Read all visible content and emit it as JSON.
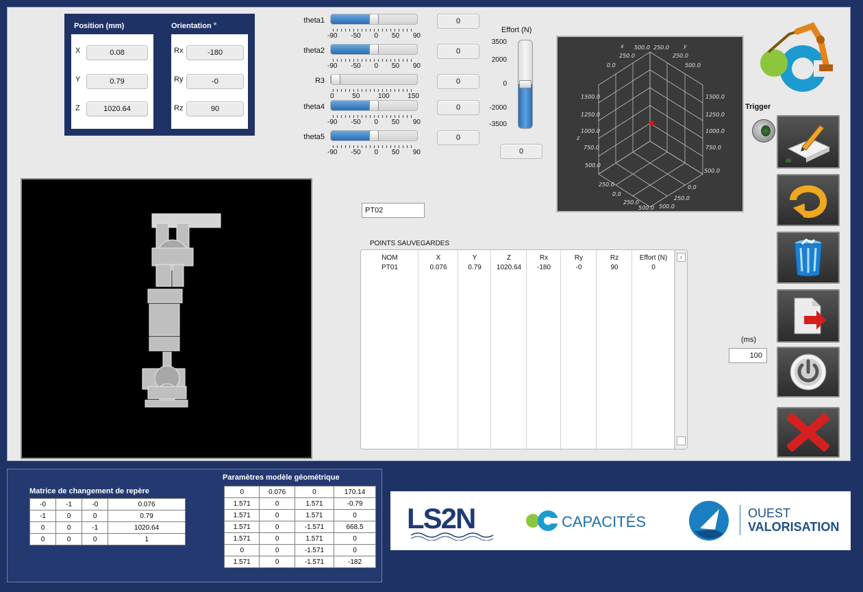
{
  "pose": {
    "position_header": "Position (mm)",
    "orientation_header": "Orientation °",
    "rows": [
      {
        "pos_label": "X",
        "pos_value": "0.08",
        "ori_label": "Rx",
        "ori_value": "-180"
      },
      {
        "pos_label": "Y",
        "pos_value": "0.79",
        "ori_label": "Ry",
        "ori_value": "-0"
      },
      {
        "pos_label": "Z",
        "pos_value": "1020.64",
        "ori_label": "Rz",
        "ori_value": "90"
      }
    ]
  },
  "joints": [
    {
      "label": "theta1",
      "value": "0",
      "fill": 0.5,
      "ticks": [
        "-90",
        "-50",
        "0",
        "50",
        "90"
      ]
    },
    {
      "label": "theta2",
      "value": "0",
      "fill": 0.5,
      "ticks": [
        "-90",
        "-50",
        "0",
        "50",
        "90"
      ]
    },
    {
      "label": "R3",
      "value": "0",
      "fill": 0.0,
      "ticks": [
        "0",
        "50",
        "100",
        "150"
      ]
    },
    {
      "label": "theta4",
      "value": "0",
      "fill": 0.5,
      "ticks": [
        "-90",
        "-50",
        "0",
        "50",
        "90"
      ]
    },
    {
      "label": "theta5",
      "value": "0",
      "fill": 0.5,
      "ticks": [
        "-90",
        "-50",
        "0",
        "50",
        "90"
      ]
    }
  ],
  "effort": {
    "title": "Effort (N)",
    "scale": [
      "3500",
      "2000",
      "0",
      "-2000",
      "-3500"
    ],
    "value": "0",
    "level": 0.5
  },
  "plot3d": {
    "labels_left": [
      "250.0",
      "0.0",
      "1500.0",
      "1250.0",
      "1000.0",
      "750.0",
      "500.0"
    ],
    "labels_right": [
      "250.0",
      "500.0",
      "1500.0",
      "1250.0",
      "1000.0",
      "750.0",
      "500.0"
    ],
    "labels_top": [
      "500.0",
      "250.0",
      "0.0",
      "250.0",
      "500.0",
      "250.0"
    ],
    "labels_bottom": [
      "250.0",
      "0.0",
      "250.0",
      "500.0",
      "500.0",
      "250.0",
      "0.0"
    ],
    "axis_x": "x",
    "axis_y": "y",
    "axis_z": "z"
  },
  "trigger": {
    "label": "Trigger"
  },
  "point_name": "PT02",
  "saved_points": {
    "title": "POINTS SAUVEGARDES",
    "columns": [
      "NOM",
      "X",
      "Y",
      "Z",
      "Rx",
      "Ry",
      "Rz",
      "Effort (N)"
    ],
    "rows": [
      [
        "PT01",
        "0.076",
        "0.79",
        "1020.64",
        "-180",
        "-0",
        "90",
        "0"
      ]
    ]
  },
  "period": {
    "unit": "(ms)",
    "value": "100"
  },
  "transform_matrix": {
    "title": "Matrice de changement de repère",
    "rows": [
      [
        "-0",
        "-1",
        "-0",
        "0.076"
      ],
      [
        "-1",
        "0",
        "0",
        "0.79"
      ],
      [
        "0",
        "0",
        "-1",
        "1020.64"
      ],
      [
        "0",
        "0",
        "0",
        "1"
      ]
    ]
  },
  "geom_params": {
    "title": "Paramètres modèle géométrique",
    "rows": [
      [
        "0",
        "0.076",
        "0",
        "170.14"
      ],
      [
        "1.571",
        "0",
        "1.571",
        "-0.79"
      ],
      [
        "1.571",
        "0",
        "1.571",
        "0"
      ],
      [
        "1.571",
        "0",
        "-1.571",
        "668.5"
      ],
      [
        "1.571",
        "0",
        "1.571",
        "0"
      ],
      [
        "0",
        "0",
        "-1.571",
        "0"
      ],
      [
        "1.571",
        "0",
        "-1.571",
        "-182"
      ]
    ]
  },
  "logos": {
    "ls2n": "LS2N",
    "capacites": "CAPACITÉS",
    "ouest_line1": "OUEST",
    "ouest_line2": "VALORISATION"
  },
  "colors": {
    "background": "#1f3266",
    "accent": "#2a6cb3",
    "stop_red": "#d42020"
  }
}
